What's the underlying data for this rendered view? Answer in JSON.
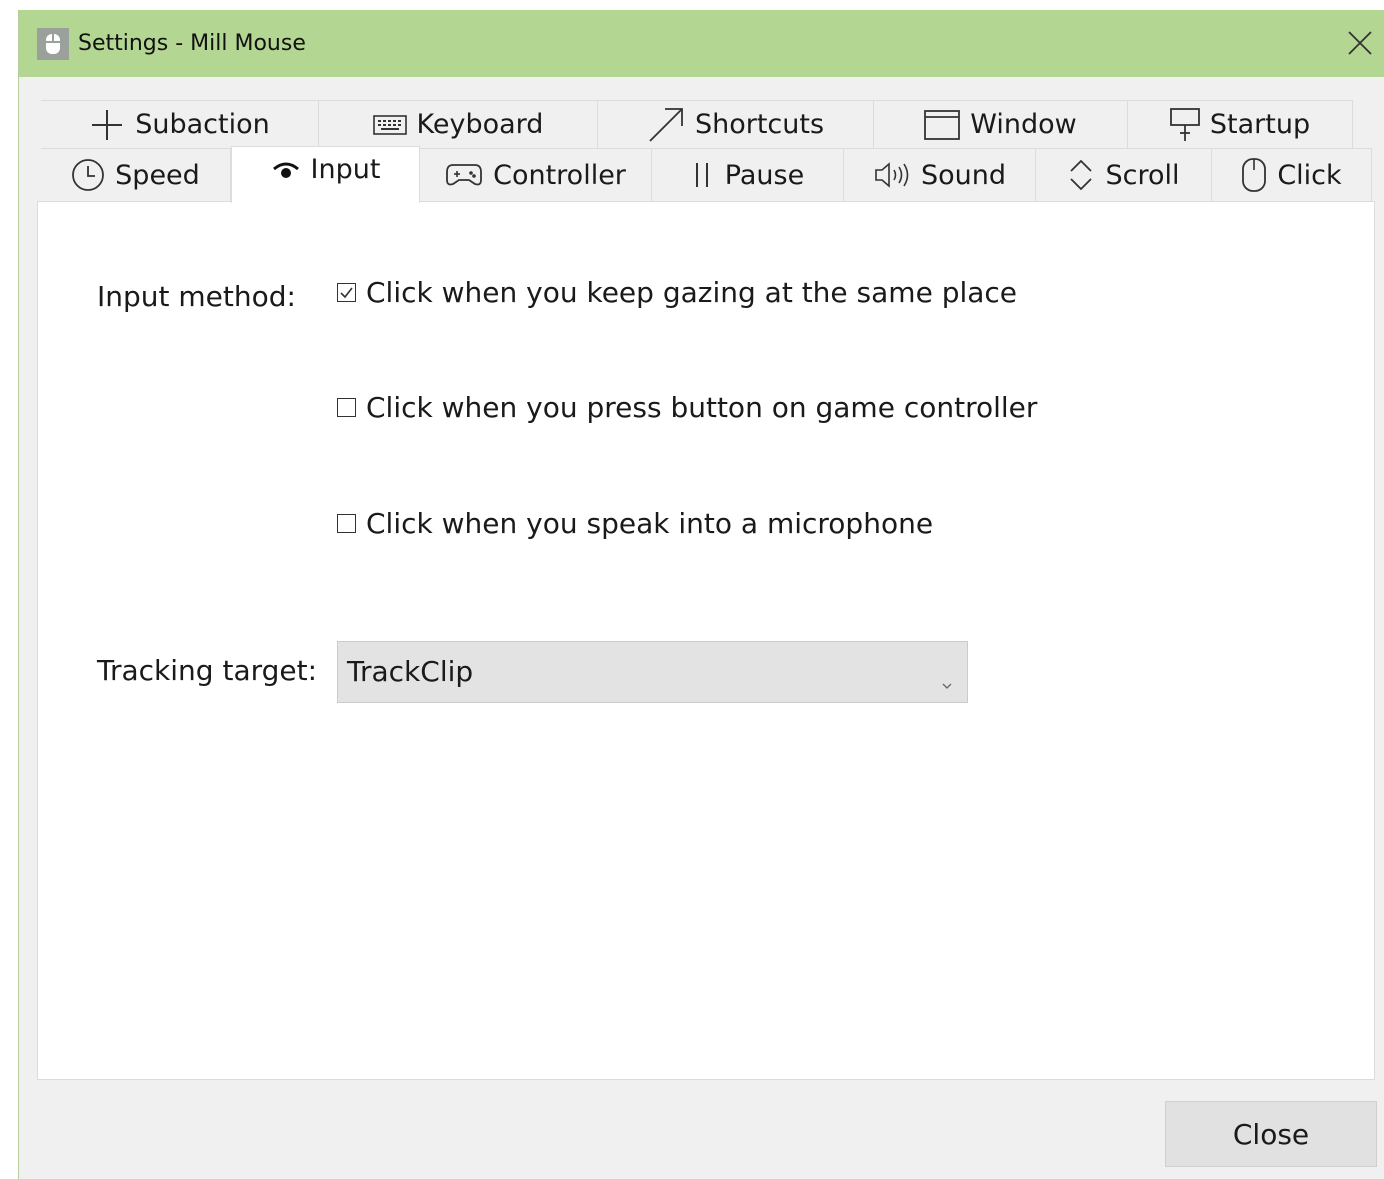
{
  "window": {
    "title": "Settings - Mill Mouse",
    "titlebar_color": "#b3d693"
  },
  "tabs_row1": [
    {
      "label": "Subaction",
      "icon": "plus-icon"
    },
    {
      "label": "Keyboard",
      "icon": "keyboard-icon"
    },
    {
      "label": "Shortcuts",
      "icon": "arrow-up-right-icon"
    },
    {
      "label": "Window",
      "icon": "window-icon"
    },
    {
      "label": "Startup",
      "icon": "sign-icon"
    }
  ],
  "tabs_row2": [
    {
      "label": "Speed",
      "icon": "clock-icon"
    },
    {
      "label": "Input",
      "icon": "eye-icon",
      "active": true
    },
    {
      "label": "Controller",
      "icon": "gamepad-icon"
    },
    {
      "label": "Pause",
      "icon": "pause-icon"
    },
    {
      "label": "Sound",
      "icon": "speaker-icon"
    },
    {
      "label": "Scroll",
      "icon": "scroll-arrows-icon"
    },
    {
      "label": "Click",
      "icon": "mouse-icon"
    }
  ],
  "input_method": {
    "label": "Input method:",
    "options": [
      {
        "label": "Click when you keep gazing at the same place",
        "checked": true
      },
      {
        "label": "Click when you press button on game controller",
        "checked": false
      },
      {
        "label": "Click when you speak into a microphone",
        "checked": false
      }
    ]
  },
  "tracking_target": {
    "label": "Tracking target:",
    "value": "TrackClip"
  },
  "footer": {
    "close_label": "Close"
  }
}
